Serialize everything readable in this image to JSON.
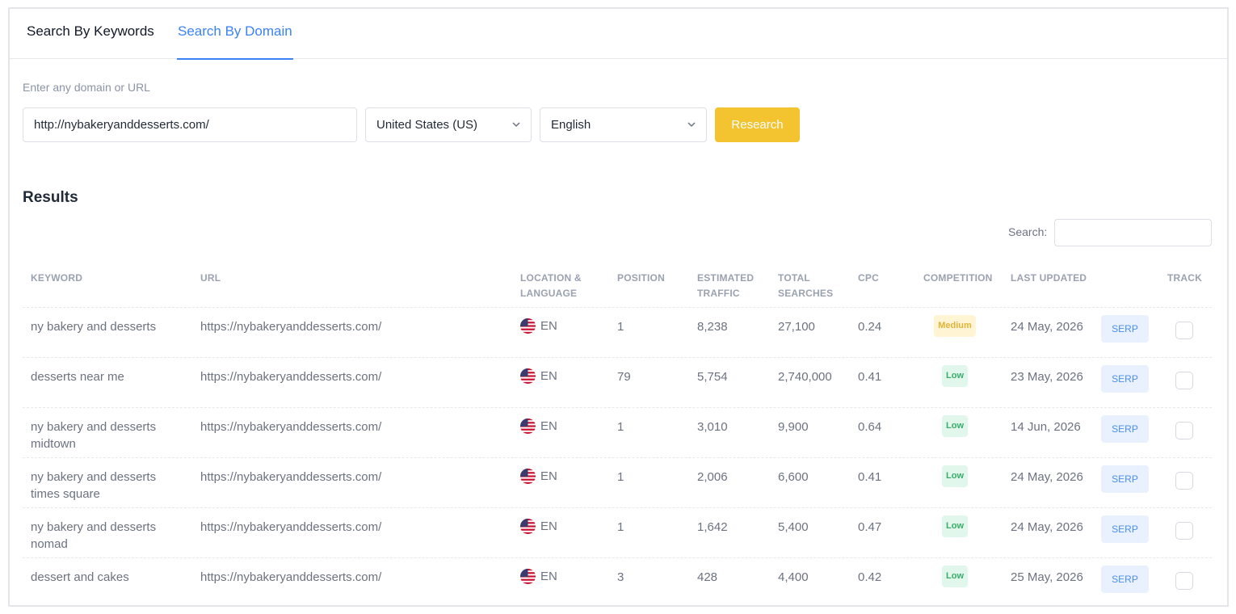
{
  "tabs": [
    {
      "label": "Search By Keywords",
      "active": false
    },
    {
      "label": "Search By Domain",
      "active": true
    }
  ],
  "form": {
    "label": "Enter any domain or URL",
    "domain_value": "http://nybakeryanddesserts.com/",
    "country": "United States (US)",
    "language": "English",
    "research_label": "Research"
  },
  "results": {
    "title": "Results",
    "search_label": "Search:",
    "search_value": ""
  },
  "table": {
    "headers": {
      "keyword": "KEYWORD",
      "url": "URL",
      "location_1": "LOCATION &",
      "location_2": "LANGUAGE",
      "position": "POSITION",
      "traffic_1": "ESTIMATED",
      "traffic_2": "TRAFFIC",
      "total_1": "TOTAL",
      "total_2": "SEARCHES",
      "cpc": "CPC",
      "competition": "COMPETITION",
      "last_updated": "LAST UPDATED",
      "track": "TRACK"
    },
    "rows": [
      {
        "keyword": "ny bakery and desserts",
        "url": "https://nybakeryanddesserts.com/",
        "lang": "EN",
        "position": "1",
        "traffic": "8,238",
        "total": "27,100",
        "cpc": "0.24",
        "competition": "Medium",
        "date": "24 May, 2026",
        "serp": "SERP"
      },
      {
        "keyword": "desserts near me",
        "url": "https://nybakeryanddesserts.com/",
        "lang": "EN",
        "position": "79",
        "traffic": "5,754",
        "total": "2,740,000",
        "cpc": "0.41",
        "competition": "Low",
        "date": "23 May, 2026",
        "serp": "SERP"
      },
      {
        "keyword": "ny bakery and desserts midtown",
        "url": "https://nybakeryanddesserts.com/",
        "lang": "EN",
        "position": "1",
        "traffic": "3,010",
        "total": "9,900",
        "cpc": "0.64",
        "competition": "Low",
        "date": "14 Jun, 2026",
        "serp": "SERP"
      },
      {
        "keyword": "ny bakery and desserts times square",
        "url": "https://nybakeryanddesserts.com/",
        "lang": "EN",
        "position": "1",
        "traffic": "2,006",
        "total": "6,600",
        "cpc": "0.41",
        "competition": "Low",
        "date": "24 May, 2026",
        "serp": "SERP"
      },
      {
        "keyword": "ny bakery and desserts nomad",
        "url": "https://nybakeryanddesserts.com/",
        "lang": "EN",
        "position": "1",
        "traffic": "1,642",
        "total": "5,400",
        "cpc": "0.47",
        "competition": "Low",
        "date": "24 May, 2026",
        "serp": "SERP"
      },
      {
        "keyword": "dessert and cakes",
        "url": "https://nybakeryanddesserts.com/",
        "lang": "EN",
        "position": "3",
        "traffic": "428",
        "total": "4,400",
        "cpc": "0.42",
        "competition": "Low",
        "date": "25 May, 2026",
        "serp": "SERP"
      }
    ]
  },
  "colors": {
    "accent": "#3b82f6",
    "research_button": "#f3c330",
    "badge_medium_bg": "#fff4d4",
    "badge_low_bg": "#e2f7ec"
  },
  "icons": [
    "chevron-down-icon",
    "us-flag-icon"
  ]
}
